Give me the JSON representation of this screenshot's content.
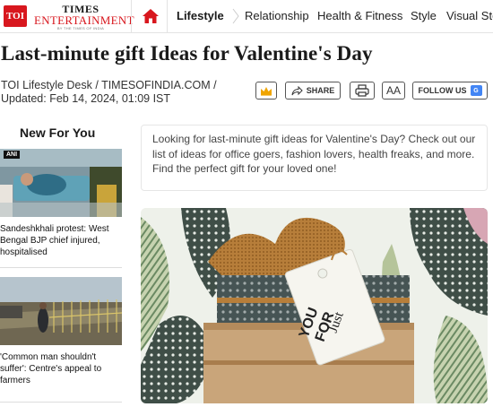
{
  "header": {
    "logo_text": "TOI",
    "brand_line1": "TIMES",
    "brand_line2": "ENTERTAINMENT",
    "brand_tagline": "BY THE TIMES OF INDIA",
    "nav_items": [
      "Lifestyle",
      "Relationship",
      "Health & Fitness",
      "Style",
      "Visual Stories"
    ],
    "active_item": "Lifestyle",
    "accent_color": "#d8171e"
  },
  "article": {
    "headline": "Last-minute gift Ideas for Valentine's Day",
    "byline_line1": "TOI Lifestyle Desk / TIMESOFINDIA.COM /",
    "byline_line2": "Updated: Feb 14, 2024, 01:09 IST",
    "summary": "Looking for last-minute gift ideas for Valentine's Day? Check out our list of ideas for office goers, fashion lovers, health freaks, and more. Find the perfect gift for your loved one!",
    "tag_text_line1": "Just",
    "tag_text_line2": "FOR",
    "tag_text_line3": "YOU"
  },
  "toolbar": {
    "crown_icon": "crown-icon",
    "share_label": "SHARE",
    "print_icon": "print-icon",
    "aa_label": "AA",
    "follow_label": "FOLLOW US",
    "gnews_label": "G"
  },
  "sidebar": {
    "title": "New For You",
    "items": [
      {
        "badge": "ANI",
        "title": "Sandeshkhali protest: West Bengal BJP chief injured, hospitalised"
      },
      {
        "badge": "",
        "title": "'Common man shouldn't suffer': Centre's appeal to farmers"
      }
    ]
  }
}
